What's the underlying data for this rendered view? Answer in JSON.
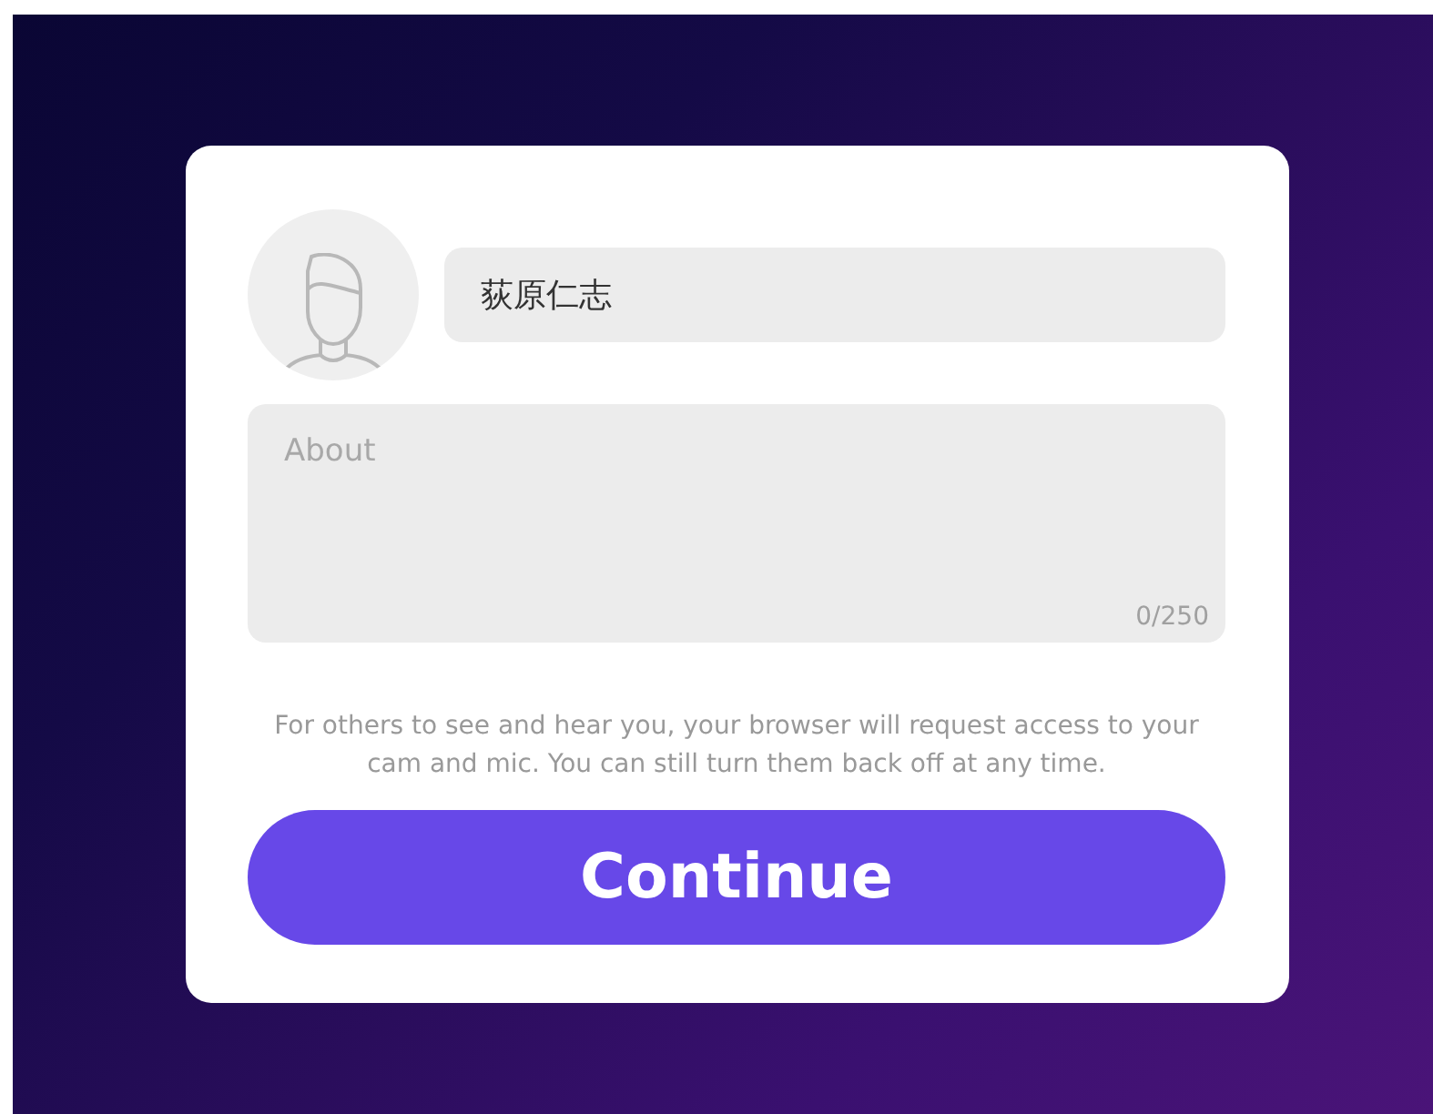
{
  "profile": {
    "name_value": "荻原仁志",
    "about": {
      "placeholder": "About",
      "counter": "0/250"
    }
  },
  "notice": "For others to see and hear you, your browser will request access to your cam and mic. You can still turn them back off at any time.",
  "buttons": [
    "Continue"
  ]
}
